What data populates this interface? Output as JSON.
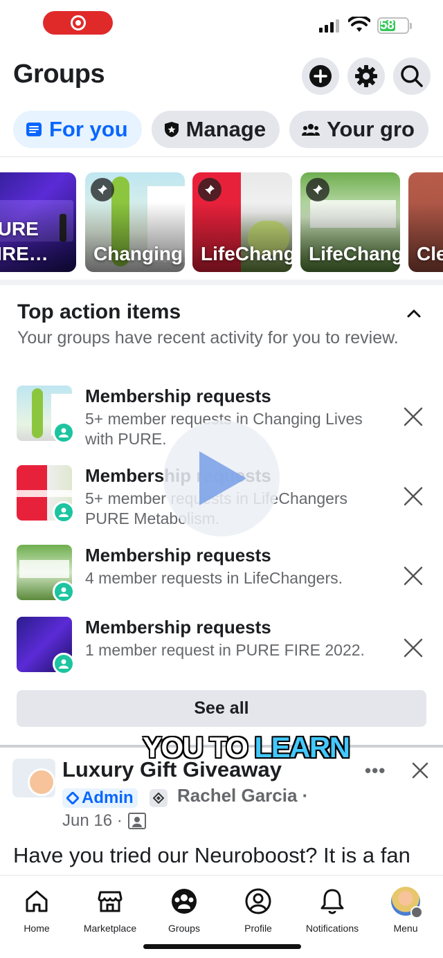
{
  "status_bar": {
    "battery_level": "58"
  },
  "header": {
    "title": "Groups",
    "buttons": [
      "create-icon",
      "gear-icon",
      "search-icon"
    ]
  },
  "tabs": [
    {
      "label": "For you",
      "active": true
    },
    {
      "label": "Manage",
      "active": false
    },
    {
      "label": "Your gro",
      "active": false
    }
  ],
  "pinned_groups": [
    {
      "name": "PURE FIRE…"
    },
    {
      "name": "Changing…"
    },
    {
      "name": "LifeChangers…"
    },
    {
      "name": "LifeChangers"
    },
    {
      "name": "Clean…"
    }
  ],
  "action_items": {
    "title": "Top action items",
    "subtitle": "Your groups have recent activity for you to review.",
    "items": [
      {
        "title": "Membership requests",
        "desc": "5+ member requests in Changing Lives with PURE."
      },
      {
        "title": "Membership requests",
        "desc": "5+ member requests in LifeChangers PURE Metabolism."
      },
      {
        "title": "Membership requests",
        "desc": "4 member requests in LifeChangers."
      },
      {
        "title": "Membership requests",
        "desc": "1 member request in PURE FIRE 2022."
      }
    ],
    "see_all": "See all"
  },
  "caption": {
    "part1": "YOU TO ",
    "part2": "LEARN"
  },
  "post": {
    "group": "Luxury Gift Giveaway",
    "admin_label": "Admin",
    "author": "Rachel Garcia ·",
    "date": "Jun 16 ·",
    "text": "Have you tried our Neuroboost? It is a fan favorite and pairs well with the…"
  },
  "bottom_nav": [
    {
      "label": "Home"
    },
    {
      "label": "Marketplace"
    },
    {
      "label": "Groups"
    },
    {
      "label": "Profile"
    },
    {
      "label": "Notifications"
    },
    {
      "label": "Menu"
    }
  ],
  "colors": {
    "accent": "#0866ff",
    "badge_green": "#1cc4a0",
    "recording": "#e02a2a"
  }
}
